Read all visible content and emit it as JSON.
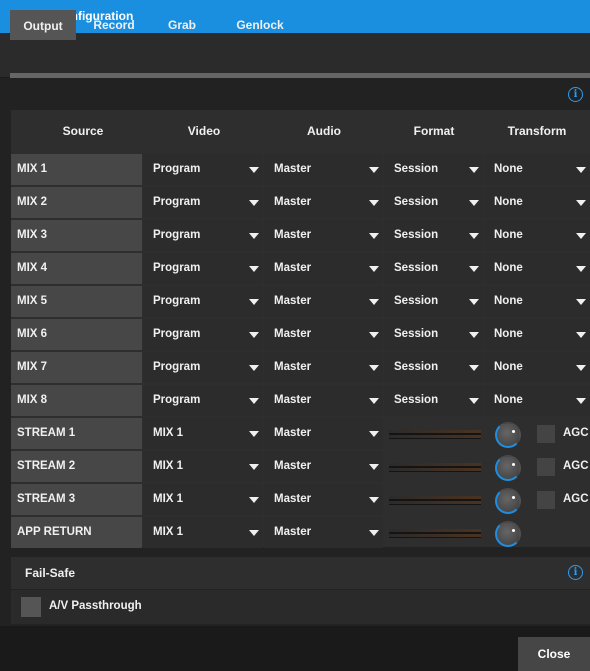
{
  "window": {
    "title": "Output Configuration"
  },
  "tabs": [
    {
      "label": "Output",
      "active": true
    },
    {
      "label": "Record",
      "active": false
    },
    {
      "label": "Grab",
      "active": false
    },
    {
      "label": "Genlock",
      "active": false
    }
  ],
  "columns": [
    "Source",
    "Video",
    "Audio",
    "Format",
    "Transform"
  ],
  "rows": [
    {
      "source": "MIX 1",
      "video": "Program",
      "audio": "Master",
      "format": "Session",
      "transform": "None"
    },
    {
      "source": "MIX 2",
      "video": "Program",
      "audio": "Master",
      "format": "Session",
      "transform": "None"
    },
    {
      "source": "MIX 3",
      "video": "Program",
      "audio": "Master",
      "format": "Session",
      "transform": "None"
    },
    {
      "source": "MIX 4",
      "video": "Program",
      "audio": "Master",
      "format": "Session",
      "transform": "None"
    },
    {
      "source": "MIX 5",
      "video": "Program",
      "audio": "Master",
      "format": "Session",
      "transform": "None"
    },
    {
      "source": "MIX 6",
      "video": "Program",
      "audio": "Master",
      "format": "Session",
      "transform": "None"
    },
    {
      "source": "MIX 7",
      "video": "Program",
      "audio": "Master",
      "format": "Session",
      "transform": "None"
    },
    {
      "source": "MIX 8",
      "video": "Program",
      "audio": "Master",
      "format": "Session",
      "transform": "None"
    }
  ],
  "streams": [
    {
      "source": "STREAM 1",
      "video": "MIX 1",
      "audio": "Master",
      "agc": "AGC"
    },
    {
      "source": "STREAM 2",
      "video": "MIX 1",
      "audio": "Master",
      "agc": "AGC"
    },
    {
      "source": "STREAM 3",
      "video": "MIX 1",
      "audio": "Master",
      "agc": "AGC"
    },
    {
      "source": "APP RETURN",
      "video": "MIX 1",
      "audio": "Master",
      "agc": ""
    }
  ],
  "failsafe": {
    "title": "Fail-Safe",
    "passthrough_label": "A/V Passthrough"
  },
  "info_icon": "i",
  "close_label": "Close",
  "colors": {
    "accent": "#1a8fe0",
    "title_bar": "#1a8fe0",
    "info": "#2a9df4"
  }
}
